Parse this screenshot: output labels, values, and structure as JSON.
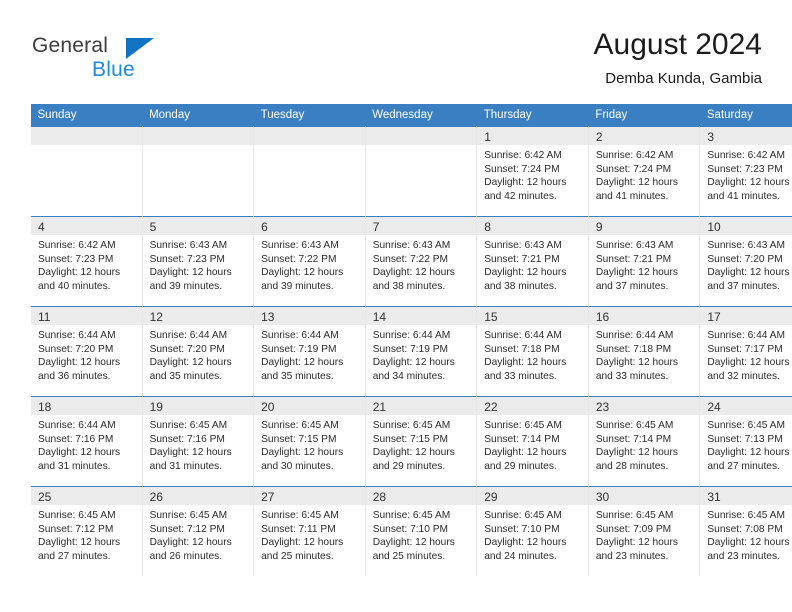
{
  "brand": {
    "name_part1": "General",
    "name_part2": "Blue",
    "triangle_color": "#1273c4",
    "blue_color": "#1e8ae0"
  },
  "header": {
    "title": "August 2024",
    "subtitle": "Demba Kunda, Gambia"
  },
  "colors": {
    "header_blue": "#3a7fc1",
    "daynum_band": "#ebebeb",
    "grid_line": "#e7e7e7",
    "text": "#2b2b2b"
  },
  "weekday_headers": [
    "Sunday",
    "Monday",
    "Tuesday",
    "Wednesday",
    "Thursday",
    "Friday",
    "Saturday"
  ],
  "labels": {
    "sunrise_prefix": "Sunrise:",
    "sunset_prefix": "Sunset:",
    "daylight_prefix": "Daylight:"
  },
  "weeks": [
    [
      {
        "day": "",
        "sunrise": "",
        "sunset": "",
        "daylight_line1": "",
        "daylight_line2": "",
        "empty": true
      },
      {
        "day": "",
        "sunrise": "",
        "sunset": "",
        "daylight_line1": "",
        "daylight_line2": "",
        "empty": true
      },
      {
        "day": "",
        "sunrise": "",
        "sunset": "",
        "daylight_line1": "",
        "daylight_line2": "",
        "empty": true
      },
      {
        "day": "",
        "sunrise": "",
        "sunset": "",
        "daylight_line1": "",
        "daylight_line2": "",
        "empty": true
      },
      {
        "day": "1",
        "sunrise": "Sunrise: 6:42 AM",
        "sunset": "Sunset: 7:24 PM",
        "daylight_line1": "Daylight: 12 hours",
        "daylight_line2": "and 42 minutes."
      },
      {
        "day": "2",
        "sunrise": "Sunrise: 6:42 AM",
        "sunset": "Sunset: 7:24 PM",
        "daylight_line1": "Daylight: 12 hours",
        "daylight_line2": "and 41 minutes."
      },
      {
        "day": "3",
        "sunrise": "Sunrise: 6:42 AM",
        "sunset": "Sunset: 7:23 PM",
        "daylight_line1": "Daylight: 12 hours",
        "daylight_line2": "and 41 minutes."
      }
    ],
    [
      {
        "day": "4",
        "sunrise": "Sunrise: 6:42 AM",
        "sunset": "Sunset: 7:23 PM",
        "daylight_line1": "Daylight: 12 hours",
        "daylight_line2": "and 40 minutes."
      },
      {
        "day": "5",
        "sunrise": "Sunrise: 6:43 AM",
        "sunset": "Sunset: 7:23 PM",
        "daylight_line1": "Daylight: 12 hours",
        "daylight_line2": "and 39 minutes."
      },
      {
        "day": "6",
        "sunrise": "Sunrise: 6:43 AM",
        "sunset": "Sunset: 7:22 PM",
        "daylight_line1": "Daylight: 12 hours",
        "daylight_line2": "and 39 minutes."
      },
      {
        "day": "7",
        "sunrise": "Sunrise: 6:43 AM",
        "sunset": "Sunset: 7:22 PM",
        "daylight_line1": "Daylight: 12 hours",
        "daylight_line2": "and 38 minutes."
      },
      {
        "day": "8",
        "sunrise": "Sunrise: 6:43 AM",
        "sunset": "Sunset: 7:21 PM",
        "daylight_line1": "Daylight: 12 hours",
        "daylight_line2": "and 38 minutes."
      },
      {
        "day": "9",
        "sunrise": "Sunrise: 6:43 AM",
        "sunset": "Sunset: 7:21 PM",
        "daylight_line1": "Daylight: 12 hours",
        "daylight_line2": "and 37 minutes."
      },
      {
        "day": "10",
        "sunrise": "Sunrise: 6:43 AM",
        "sunset": "Sunset: 7:20 PM",
        "daylight_line1": "Daylight: 12 hours",
        "daylight_line2": "and 37 minutes."
      }
    ],
    [
      {
        "day": "11",
        "sunrise": "Sunrise: 6:44 AM",
        "sunset": "Sunset: 7:20 PM",
        "daylight_line1": "Daylight: 12 hours",
        "daylight_line2": "and 36 minutes."
      },
      {
        "day": "12",
        "sunrise": "Sunrise: 6:44 AM",
        "sunset": "Sunset: 7:20 PM",
        "daylight_line1": "Daylight: 12 hours",
        "daylight_line2": "and 35 minutes."
      },
      {
        "day": "13",
        "sunrise": "Sunrise: 6:44 AM",
        "sunset": "Sunset: 7:19 PM",
        "daylight_line1": "Daylight: 12 hours",
        "daylight_line2": "and 35 minutes."
      },
      {
        "day": "14",
        "sunrise": "Sunrise: 6:44 AM",
        "sunset": "Sunset: 7:19 PM",
        "daylight_line1": "Daylight: 12 hours",
        "daylight_line2": "and 34 minutes."
      },
      {
        "day": "15",
        "sunrise": "Sunrise: 6:44 AM",
        "sunset": "Sunset: 7:18 PM",
        "daylight_line1": "Daylight: 12 hours",
        "daylight_line2": "and 33 minutes."
      },
      {
        "day": "16",
        "sunrise": "Sunrise: 6:44 AM",
        "sunset": "Sunset: 7:18 PM",
        "daylight_line1": "Daylight: 12 hours",
        "daylight_line2": "and 33 minutes."
      },
      {
        "day": "17",
        "sunrise": "Sunrise: 6:44 AM",
        "sunset": "Sunset: 7:17 PM",
        "daylight_line1": "Daylight: 12 hours",
        "daylight_line2": "and 32 minutes."
      }
    ],
    [
      {
        "day": "18",
        "sunrise": "Sunrise: 6:44 AM",
        "sunset": "Sunset: 7:16 PM",
        "daylight_line1": "Daylight: 12 hours",
        "daylight_line2": "and 31 minutes."
      },
      {
        "day": "19",
        "sunrise": "Sunrise: 6:45 AM",
        "sunset": "Sunset: 7:16 PM",
        "daylight_line1": "Daylight: 12 hours",
        "daylight_line2": "and 31 minutes."
      },
      {
        "day": "20",
        "sunrise": "Sunrise: 6:45 AM",
        "sunset": "Sunset: 7:15 PM",
        "daylight_line1": "Daylight: 12 hours",
        "daylight_line2": "and 30 minutes."
      },
      {
        "day": "21",
        "sunrise": "Sunrise: 6:45 AM",
        "sunset": "Sunset: 7:15 PM",
        "daylight_line1": "Daylight: 12 hours",
        "daylight_line2": "and 29 minutes."
      },
      {
        "day": "22",
        "sunrise": "Sunrise: 6:45 AM",
        "sunset": "Sunset: 7:14 PM",
        "daylight_line1": "Daylight: 12 hours",
        "daylight_line2": "and 29 minutes."
      },
      {
        "day": "23",
        "sunrise": "Sunrise: 6:45 AM",
        "sunset": "Sunset: 7:14 PM",
        "daylight_line1": "Daylight: 12 hours",
        "daylight_line2": "and 28 minutes."
      },
      {
        "day": "24",
        "sunrise": "Sunrise: 6:45 AM",
        "sunset": "Sunset: 7:13 PM",
        "daylight_line1": "Daylight: 12 hours",
        "daylight_line2": "and 27 minutes."
      }
    ],
    [
      {
        "day": "25",
        "sunrise": "Sunrise: 6:45 AM",
        "sunset": "Sunset: 7:12 PM",
        "daylight_line1": "Daylight: 12 hours",
        "daylight_line2": "and 27 minutes."
      },
      {
        "day": "26",
        "sunrise": "Sunrise: 6:45 AM",
        "sunset": "Sunset: 7:12 PM",
        "daylight_line1": "Daylight: 12 hours",
        "daylight_line2": "and 26 minutes."
      },
      {
        "day": "27",
        "sunrise": "Sunrise: 6:45 AM",
        "sunset": "Sunset: 7:11 PM",
        "daylight_line1": "Daylight: 12 hours",
        "daylight_line2": "and 25 minutes."
      },
      {
        "day": "28",
        "sunrise": "Sunrise: 6:45 AM",
        "sunset": "Sunset: 7:10 PM",
        "daylight_line1": "Daylight: 12 hours",
        "daylight_line2": "and 25 minutes."
      },
      {
        "day": "29",
        "sunrise": "Sunrise: 6:45 AM",
        "sunset": "Sunset: 7:10 PM",
        "daylight_line1": "Daylight: 12 hours",
        "daylight_line2": "and 24 minutes."
      },
      {
        "day": "30",
        "sunrise": "Sunrise: 6:45 AM",
        "sunset": "Sunset: 7:09 PM",
        "daylight_line1": "Daylight: 12 hours",
        "daylight_line2": "and 23 minutes."
      },
      {
        "day": "31",
        "sunrise": "Sunrise: 6:45 AM",
        "sunset": "Sunset: 7:08 PM",
        "daylight_line1": "Daylight: 12 hours",
        "daylight_line2": "and 23 minutes."
      }
    ]
  ]
}
